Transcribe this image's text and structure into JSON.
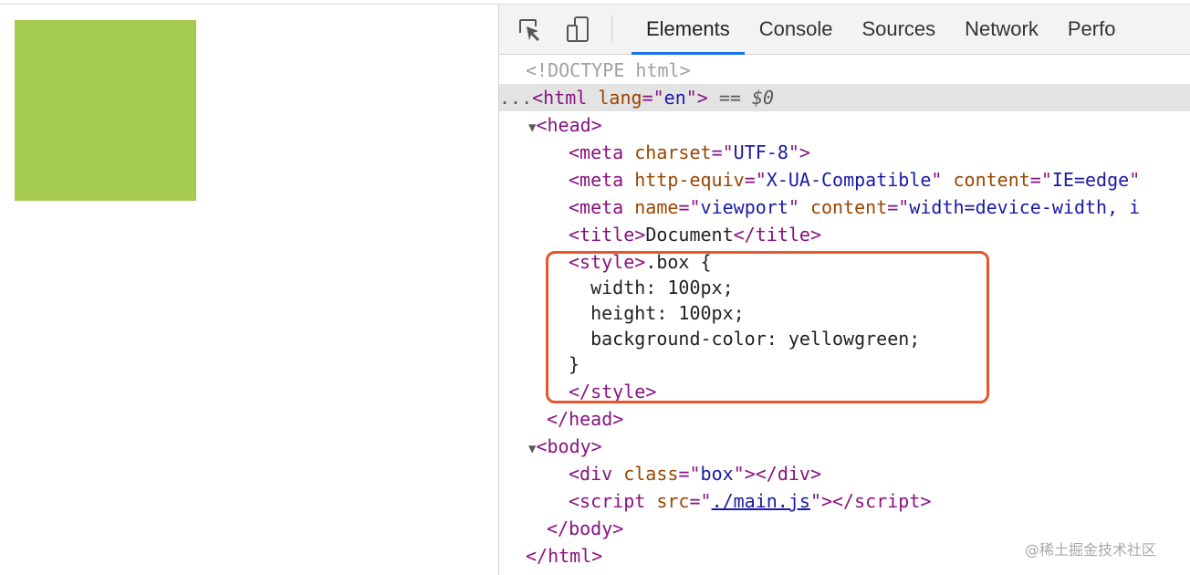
{
  "preview": {
    "box_color": "#a6cb51"
  },
  "devtools": {
    "tabs": [
      "Elements",
      "Console",
      "Sources",
      "Network",
      "Perfo"
    ],
    "active_tab": "Elements",
    "selected_suffix": "== $0",
    "ellipsis": "...",
    "dom": {
      "doctype": "<!DOCTYPE html>",
      "html_tag": "html",
      "lang_attr": "lang",
      "lang_val": "en",
      "head_tag": "head",
      "meta_tag": "meta",
      "charset_attr": "charset",
      "charset_val": "UTF-8",
      "http_equiv_attr": "http-equiv",
      "http_equiv_val": "X-UA-Compatible",
      "content_attr": "content",
      "content_val_1": "IE=edge",
      "name_attr": "name",
      "name_val": "viewport",
      "content_val_2": "width=device-width, i",
      "title_tag": "title",
      "title_text": "Document",
      "style_tag": "style",
      "css_lines": [
        ".box {",
        "  width: 100px;",
        "  height: 100px;",
        "  background-color: yellowgreen;",
        "}"
      ],
      "body_tag": "body",
      "div_tag": "div",
      "class_attr": "class",
      "class_val": "box",
      "script_tag": "script",
      "src_attr": "src",
      "src_val": "./main.js"
    }
  },
  "watermark": "@稀土掘金技术社区",
  "colors": {
    "highlight": "#e8552b",
    "tab_underline": "#1a73e8",
    "tag": "#881280",
    "attr": "#994500",
    "value": "#1a1aa6"
  }
}
